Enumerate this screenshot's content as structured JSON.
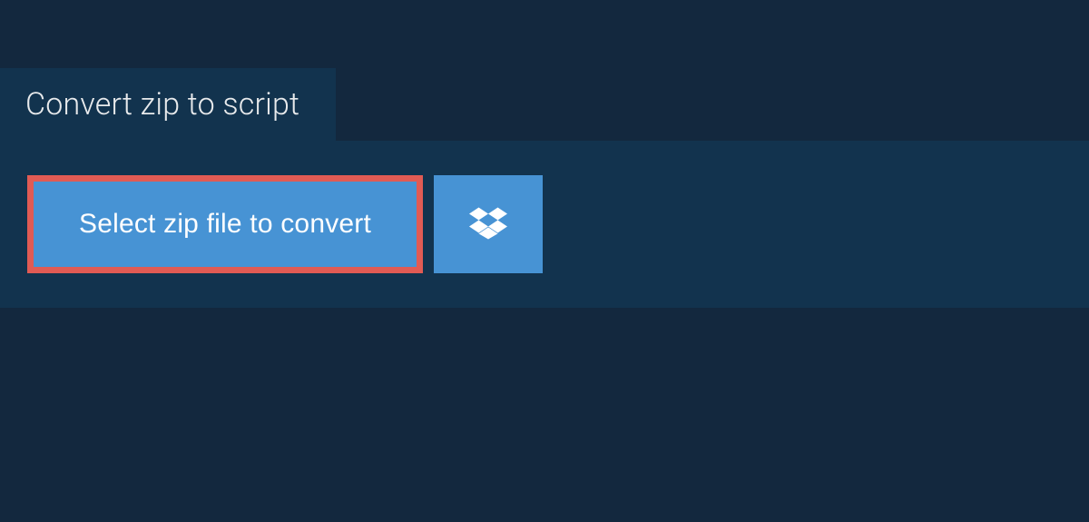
{
  "tab": {
    "label": "Convert zip to script"
  },
  "actions": {
    "select_label": "Select zip file to convert"
  },
  "colors": {
    "highlight_border": "#e15b54",
    "button_bg": "#4793d4",
    "panel_bg": "#12334e",
    "page_bg": "#13283e"
  }
}
